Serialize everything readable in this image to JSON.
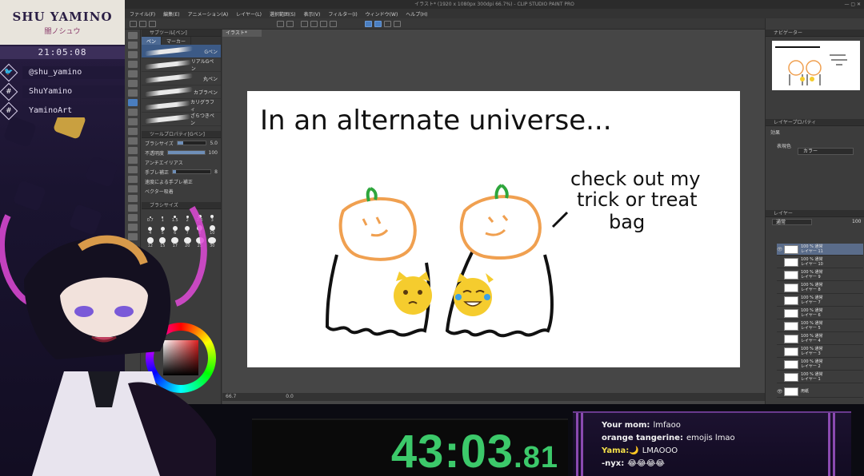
{
  "overlay": {
    "streamer_name": "SHU YAMINO",
    "streamer_name_jp": "闇ノシュウ",
    "clock": "21:05:08",
    "socials": [
      {
        "icon": "twitter-icon",
        "glyph": "🐦",
        "label": "@shu_yamino"
      },
      {
        "icon": "hashtag-icon",
        "glyph": "#",
        "label": "ShuYamino"
      },
      {
        "icon": "hashtag-icon",
        "glyph": "#",
        "label": "YaminoArt"
      }
    ]
  },
  "app": {
    "title": "イラスト* (1920 x 1080px 300dpi 66.7%) - CLIP STUDIO PAINT PRO",
    "window_controls": "—  ▢  ✕",
    "menu": [
      "ファイル(F)",
      "編集(E)",
      "アニメーション(A)",
      "レイヤー(L)",
      "選択範囲(S)",
      "表示(V)",
      "フィルター(I)",
      "ウィンドウ(W)",
      "ヘルプ(H)"
    ],
    "doc_tab": "イラスト*",
    "subtool_panel": {
      "header": "サブツール[ペン]",
      "tabs": [
        "ペン",
        "マーカー"
      ],
      "brushes": [
        "Gペン",
        "リアルGペン",
        "丸ペン",
        "カブラペン",
        "カリグラフィ",
        "ざらつきペン"
      ]
    },
    "tool_property": {
      "header": "ツールプロパティ[Gペン]",
      "brush_size_label": "ブラシサイズ",
      "brush_size_value": "5.0",
      "opacity_label": "不透明度",
      "opacity_value": "100",
      "antialias_label": "アンチエイリアス",
      "stabilization_label": "手ブレ補正",
      "stabilization_value": "8",
      "speed_check_label": "速度による手ブレ補正",
      "vector_label": "ベクター吸着"
    },
    "brush_size_panel": {
      "header": "ブラシサイズ",
      "sizes": [
        "0.7",
        "1",
        "1.5",
        "2",
        "2.5",
        "3",
        "4",
        "5",
        "6",
        "7",
        "8",
        "10",
        "12",
        "15",
        "17",
        "20",
        "25",
        "30"
      ]
    },
    "canvas_text": {
      "headline": "In an alternate universe...",
      "speech_line1": "check out my",
      "speech_line2": "trick or treat",
      "speech_line3": "bag"
    },
    "statusbar": {
      "zoom": "66.7",
      "rotation": "0.0"
    },
    "navigator_header": "ナビゲーター",
    "layer_property_header": "レイヤープロパティ",
    "effect_label": "効果",
    "expression_color_label": "表現色",
    "expression_color_value": "カラー",
    "layer_panel_header": "レイヤー",
    "blend_mode": "通常",
    "layer_opacity": "100",
    "layers": [
      {
        "line1": "100 % 通常",
        "line2": "レイヤー 11",
        "selected": true
      },
      {
        "line1": "100 % 通常",
        "line2": "レイヤー 10"
      },
      {
        "line1": "100 % 通常",
        "line2": "レイヤー 9"
      },
      {
        "line1": "100 % 通常",
        "line2": "レイヤー 8"
      },
      {
        "line1": "100 % 通常",
        "line2": "レイヤー 7"
      },
      {
        "line1": "100 % 通常",
        "line2": "レイヤー 6"
      },
      {
        "line1": "100 % 通常",
        "line2": "レイヤー 5"
      },
      {
        "line1": "100 % 通常",
        "line2": "レイヤー 4"
      },
      {
        "line1": "100 % 通常",
        "line2": "レイヤー 3"
      },
      {
        "line1": "100 % 通常",
        "line2": "レイヤー 2"
      },
      {
        "line1": "100 % 通常",
        "line2": "レイヤー 1"
      },
      {
        "line1": "",
        "line2": "用紙"
      }
    ]
  },
  "timer": {
    "main": "43:03",
    "fraction": ".81",
    "color": "#3cc96a"
  },
  "chat": [
    {
      "user": "Your mom:",
      "text": "lmfaoo",
      "user_color": "#f2f2f2"
    },
    {
      "user": "orange tangerine:",
      "text": "emojis lmao",
      "user_color": "#f2f2f2"
    },
    {
      "user": "Yama:🌙",
      "text": "LMAOOO",
      "user_color": "#f4e04a"
    },
    {
      "user": "-nyx:",
      "text": "😂😂😂😂",
      "user_color": "#f2f2f2"
    }
  ]
}
